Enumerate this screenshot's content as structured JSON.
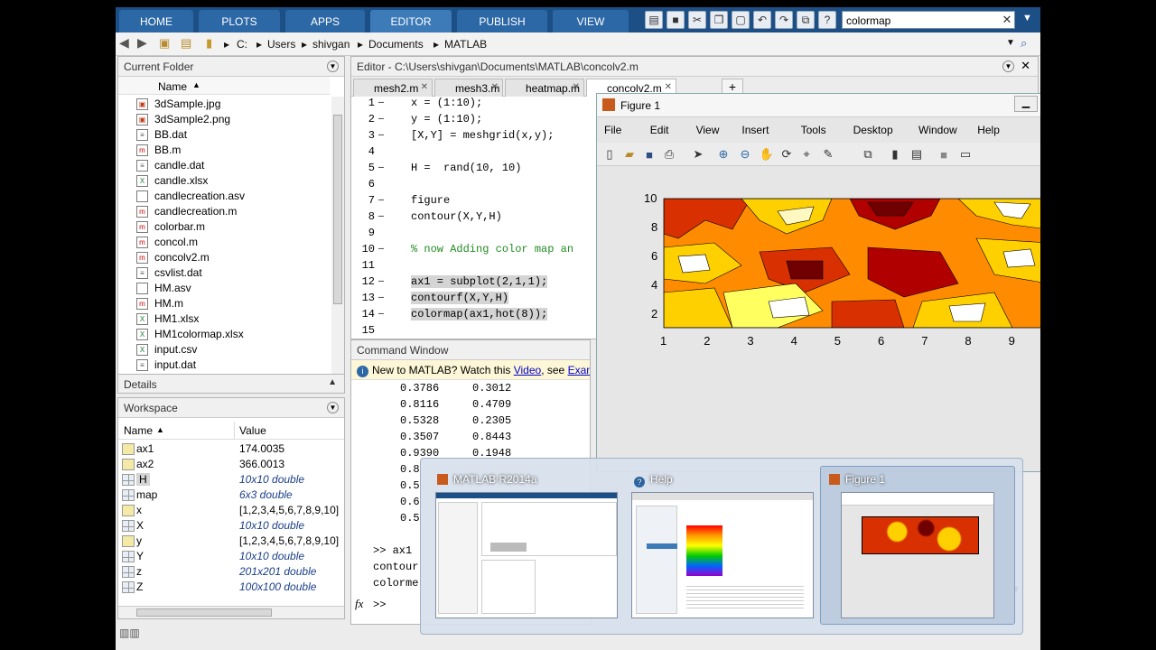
{
  "ribbon": {
    "tabs": [
      "HOME",
      "PLOTS",
      "APPS",
      "EDITOR",
      "PUBLISH",
      "VIEW"
    ],
    "active_tab": "EDITOR",
    "search_value": "colormap"
  },
  "address_bar": {
    "path": [
      "C:",
      "Users",
      "shivgan",
      "Documents",
      "MATLAB"
    ]
  },
  "current_folder": {
    "title": "Current Folder",
    "column": "Name",
    "files": [
      {
        "name": "3dSample.jpg",
        "icon": "image-file-icon"
      },
      {
        "name": "3dSample2.png",
        "icon": "image-file-icon"
      },
      {
        "name": "BB.dat",
        "icon": "data-file-icon"
      },
      {
        "name": "BB.m",
        "icon": "m-file-icon"
      },
      {
        "name": "candle.dat",
        "icon": "data-file-icon"
      },
      {
        "name": "candle.xlsx",
        "icon": "excel-file-icon"
      },
      {
        "name": "candlecreation.asv",
        "icon": "generic-file-icon"
      },
      {
        "name": "candlecreation.m",
        "icon": "m-file-icon"
      },
      {
        "name": "colorbar.m",
        "icon": "m-file-icon"
      },
      {
        "name": "concol.m",
        "icon": "m-file-icon"
      },
      {
        "name": "concolv2.m",
        "icon": "m-file-icon"
      },
      {
        "name": "csvlist.dat",
        "icon": "data-file-icon"
      },
      {
        "name": "HM.asv",
        "icon": "generic-file-icon"
      },
      {
        "name": "HM.m",
        "icon": "m-file-icon"
      },
      {
        "name": "HM1.xlsx",
        "icon": "excel-file-icon"
      },
      {
        "name": "HM1colormap.xlsx",
        "icon": "excel-file-icon"
      },
      {
        "name": "input.csv",
        "icon": "excel-file-icon"
      },
      {
        "name": "input.dat",
        "icon": "data-file-icon"
      }
    ],
    "details_label": "Details"
  },
  "workspace": {
    "title": "Workspace",
    "columns": [
      "Name",
      "Value"
    ],
    "vars": [
      {
        "name": "ax1",
        "value": "174.0035",
        "italic": false
      },
      {
        "name": "ax2",
        "value": "366.0013",
        "italic": false
      },
      {
        "name": "H",
        "value": "10x10 double",
        "italic": true
      },
      {
        "name": "map",
        "value": "6x3 double",
        "italic": true
      },
      {
        "name": "x",
        "value": "[1,2,3,4,5,6,7,8,9,10]",
        "italic": false
      },
      {
        "name": "X",
        "value": "10x10 double",
        "italic": true
      },
      {
        "name": "y",
        "value": "[1,2,3,4,5,6,7,8,9,10]",
        "italic": false
      },
      {
        "name": "Y",
        "value": "10x10 double",
        "italic": true
      },
      {
        "name": "z",
        "value": "201x201 double",
        "italic": true
      },
      {
        "name": "Z",
        "value": "100x100 double",
        "italic": true
      }
    ]
  },
  "editor": {
    "title": "Editor - C:\\Users\\shivgan\\Documents\\MATLAB\\concolv2.m",
    "tabs": [
      "mesh2.m",
      "mesh3.m",
      "heatmap.m",
      "concolv2.m"
    ],
    "active_tab": "concolv2.m",
    "lines": [
      {
        "n": "1",
        "text": "x = (1:10);"
      },
      {
        "n": "2",
        "text": "y = (1:10);"
      },
      {
        "n": "3",
        "text": "[X,Y] = meshgrid(x,y);"
      },
      {
        "n": "4",
        "text": ""
      },
      {
        "n": "5",
        "text": "H =  rand(10, 10)"
      },
      {
        "n": "6",
        "text": ""
      },
      {
        "n": "7",
        "text": "figure"
      },
      {
        "n": "8",
        "text": "contour(X,Y,H)"
      },
      {
        "n": "9",
        "text": ""
      },
      {
        "n": "10",
        "text": "% now Adding color map an"
      },
      {
        "n": "11",
        "text": ""
      },
      {
        "n": "12",
        "text": "ax1 = subplot(2,1,1);"
      },
      {
        "n": "13",
        "text": "contourf(X,Y,H)"
      },
      {
        "n": "14",
        "text": "colormap(ax1,hot(8));"
      },
      {
        "n": "15",
        "text": ""
      }
    ]
  },
  "command_window": {
    "title": "Command Window",
    "notice_prefix": "New to MATLAB? Watch this ",
    "notice_link1": "Video",
    "notice_mid": ", see ",
    "notice_link2": "Exam",
    "output": [
      [
        "0.3786",
        "0.3012"
      ],
      [
        "0.8116",
        "0.4709"
      ],
      [
        "0.5328",
        "0.2305"
      ],
      [
        "0.3507",
        "0.8443"
      ],
      [
        "0.9390",
        "0.1948"
      ],
      [
        "0.8",
        ""
      ],
      [
        "0.5",
        ""
      ],
      [
        "0.6",
        ""
      ],
      [
        "0.5",
        ""
      ]
    ],
    "history": [
      ">> ax1",
      "contour",
      "colorme"
    ],
    "prompt": ">>"
  },
  "figure": {
    "title": "Figure 1",
    "menu": [
      "File",
      "Edit",
      "View",
      "Insert",
      "Tools",
      "Desktop",
      "Window",
      "Help"
    ],
    "y_ticks": [
      "10",
      "8",
      "6",
      "4",
      "2"
    ],
    "x_ticks": [
      "1",
      "2",
      "3",
      "4",
      "5",
      "6",
      "7",
      "8",
      "9"
    ]
  },
  "task_switcher": {
    "items": [
      {
        "title": "MATLAB R2014a"
      },
      {
        "title": "Help"
      },
      {
        "title": "Figure 1"
      }
    ]
  }
}
